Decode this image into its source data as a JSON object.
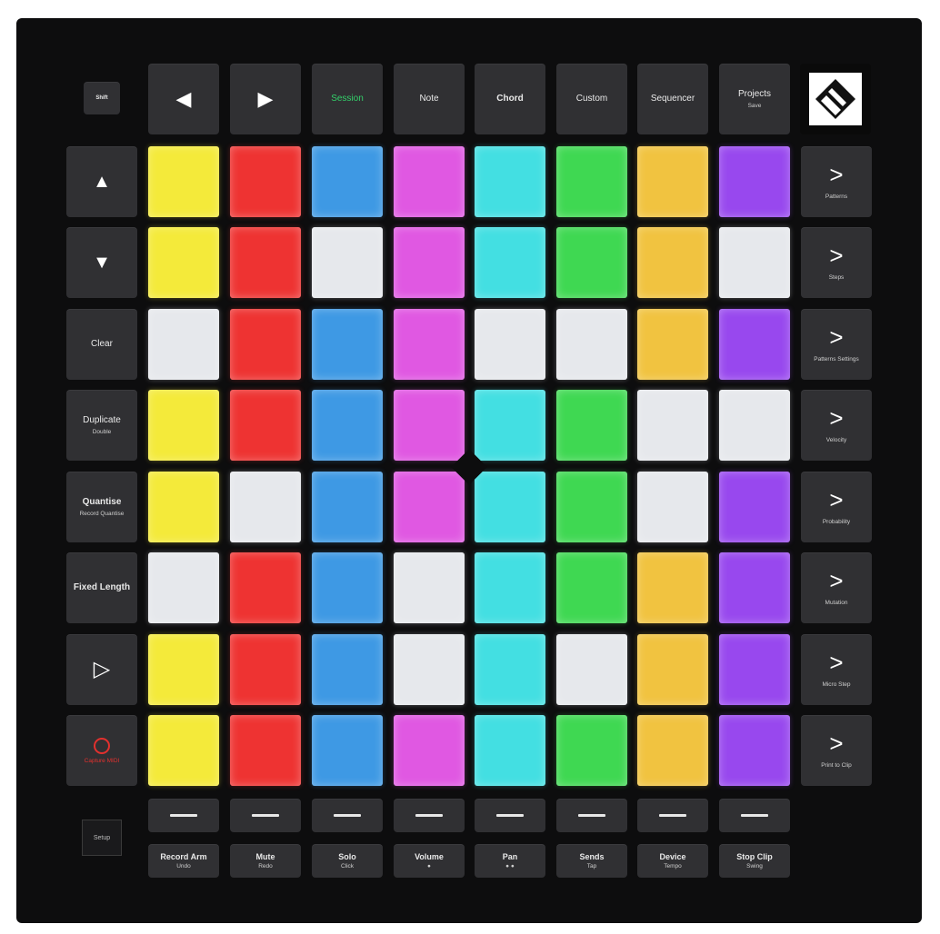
{
  "colors": {
    "yellow": "#f4ea3a",
    "red": "#ee3332",
    "blue": "#3e99e4",
    "magenta": "#e058e2",
    "cyan": "#43dfe2",
    "green": "#3fd852",
    "amber": "#f1c340",
    "purple": "#9848ee",
    "white": "#e6e8ec",
    "session_text": "#33d06a",
    "record_red": "#e2302e"
  },
  "top_row": {
    "shift": "Shift",
    "up_icon": "arrow-left-icon",
    "session": "Session",
    "note": "Note",
    "chord": "Chord",
    "custom": "Custom",
    "sequencer": "Sequencer",
    "projects": "Projects",
    "projects_sub": "Save"
  },
  "left_col": {
    "up": "▲",
    "down": "▼",
    "clear": "Clear",
    "duplicate": "Duplicate",
    "duplicate_sub": "Double",
    "quantise": "Quantise",
    "quantise_sub": "Record Quantise",
    "fixed_length": "Fixed Length",
    "play": "▷",
    "capture": "Capture MIDI"
  },
  "right_col": [
    {
      "glyph": ">",
      "sub": "Patterns"
    },
    {
      "glyph": ">",
      "sub": "Steps"
    },
    {
      "glyph": ">",
      "sub": "Patterns Settings"
    },
    {
      "glyph": ">",
      "sub": "Velocity"
    },
    {
      "glyph": ">",
      "sub": "Probability"
    },
    {
      "glyph": ">",
      "sub": "Mutation"
    },
    {
      "glyph": ">",
      "sub": "Micro Step"
    },
    {
      "glyph": ">",
      "sub": "Print to Clip"
    }
  ],
  "grid": [
    [
      "yellow",
      "red",
      "blue",
      "magenta",
      "cyan",
      "green",
      "amber",
      "purple"
    ],
    [
      "yellow",
      "red",
      "white",
      "magenta",
      "cyan",
      "green",
      "amber",
      "white"
    ],
    [
      "white",
      "red",
      "blue",
      "magenta",
      "white",
      "white",
      "amber",
      "purple"
    ],
    [
      "yellow",
      "red",
      "blue",
      "magenta",
      "cyan",
      "green",
      "white",
      "white"
    ],
    [
      "yellow",
      "white",
      "blue",
      "magenta",
      "cyan",
      "green",
      "white",
      "purple"
    ],
    [
      "white",
      "red",
      "blue",
      "white",
      "cyan",
      "green",
      "amber",
      "purple"
    ],
    [
      "yellow",
      "red",
      "blue",
      "white",
      "cyan",
      "white",
      "amber",
      "purple"
    ],
    [
      "yellow",
      "red",
      "blue",
      "magenta",
      "cyan",
      "green",
      "amber",
      "purple"
    ]
  ],
  "bottom": {
    "setup": "Setup",
    "buttons": [
      {
        "label": "Record Arm",
        "sub": "Undo"
      },
      {
        "label": "Mute",
        "sub": "Redo"
      },
      {
        "label": "Solo",
        "sub": "Click"
      },
      {
        "label": "Volume",
        "sub": "●"
      },
      {
        "label": "Pan",
        "sub": "● ●"
      },
      {
        "label": "Sends",
        "sub": "Tap"
      },
      {
        "label": "Device",
        "sub": "Tempo"
      },
      {
        "label": "Stop Clip",
        "sub": "Swing"
      }
    ]
  }
}
